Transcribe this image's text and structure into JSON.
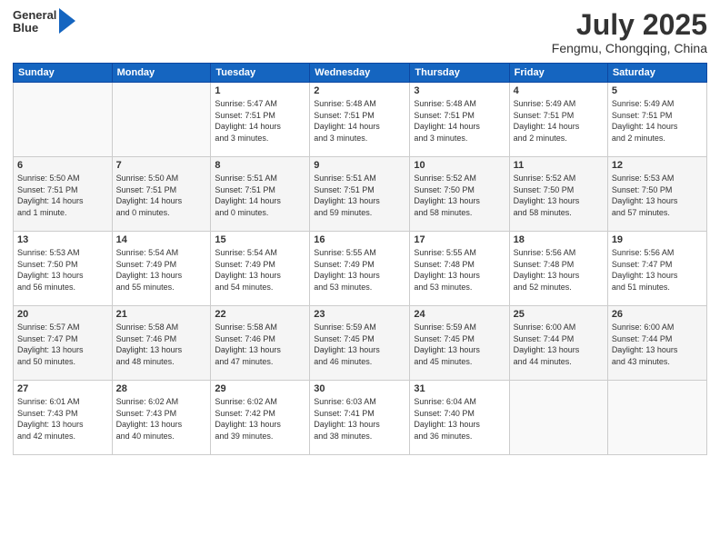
{
  "header": {
    "logo": {
      "general": "General",
      "blue": "Blue",
      "arrow_color": "#1565c0"
    },
    "month_title": "July 2025",
    "location": "Fengmu, Chongqing, China"
  },
  "calendar": {
    "days_of_week": [
      "Sunday",
      "Monday",
      "Tuesday",
      "Wednesday",
      "Thursday",
      "Friday",
      "Saturday"
    ],
    "weeks": [
      [
        {
          "day": "",
          "info": ""
        },
        {
          "day": "",
          "info": ""
        },
        {
          "day": "1",
          "info": "Sunrise: 5:47 AM\nSunset: 7:51 PM\nDaylight: 14 hours\nand 3 minutes."
        },
        {
          "day": "2",
          "info": "Sunrise: 5:48 AM\nSunset: 7:51 PM\nDaylight: 14 hours\nand 3 minutes."
        },
        {
          "day": "3",
          "info": "Sunrise: 5:48 AM\nSunset: 7:51 PM\nDaylight: 14 hours\nand 3 minutes."
        },
        {
          "day": "4",
          "info": "Sunrise: 5:49 AM\nSunset: 7:51 PM\nDaylight: 14 hours\nand 2 minutes."
        },
        {
          "day": "5",
          "info": "Sunrise: 5:49 AM\nSunset: 7:51 PM\nDaylight: 14 hours\nand 2 minutes."
        }
      ],
      [
        {
          "day": "6",
          "info": "Sunrise: 5:50 AM\nSunset: 7:51 PM\nDaylight: 14 hours\nand 1 minute."
        },
        {
          "day": "7",
          "info": "Sunrise: 5:50 AM\nSunset: 7:51 PM\nDaylight: 14 hours\nand 0 minutes."
        },
        {
          "day": "8",
          "info": "Sunrise: 5:51 AM\nSunset: 7:51 PM\nDaylight: 14 hours\nand 0 minutes."
        },
        {
          "day": "9",
          "info": "Sunrise: 5:51 AM\nSunset: 7:51 PM\nDaylight: 13 hours\nand 59 minutes."
        },
        {
          "day": "10",
          "info": "Sunrise: 5:52 AM\nSunset: 7:50 PM\nDaylight: 13 hours\nand 58 minutes."
        },
        {
          "day": "11",
          "info": "Sunrise: 5:52 AM\nSunset: 7:50 PM\nDaylight: 13 hours\nand 58 minutes."
        },
        {
          "day": "12",
          "info": "Sunrise: 5:53 AM\nSunset: 7:50 PM\nDaylight: 13 hours\nand 57 minutes."
        }
      ],
      [
        {
          "day": "13",
          "info": "Sunrise: 5:53 AM\nSunset: 7:50 PM\nDaylight: 13 hours\nand 56 minutes."
        },
        {
          "day": "14",
          "info": "Sunrise: 5:54 AM\nSunset: 7:49 PM\nDaylight: 13 hours\nand 55 minutes."
        },
        {
          "day": "15",
          "info": "Sunrise: 5:54 AM\nSunset: 7:49 PM\nDaylight: 13 hours\nand 54 minutes."
        },
        {
          "day": "16",
          "info": "Sunrise: 5:55 AM\nSunset: 7:49 PM\nDaylight: 13 hours\nand 53 minutes."
        },
        {
          "day": "17",
          "info": "Sunrise: 5:55 AM\nSunset: 7:48 PM\nDaylight: 13 hours\nand 53 minutes."
        },
        {
          "day": "18",
          "info": "Sunrise: 5:56 AM\nSunset: 7:48 PM\nDaylight: 13 hours\nand 52 minutes."
        },
        {
          "day": "19",
          "info": "Sunrise: 5:56 AM\nSunset: 7:47 PM\nDaylight: 13 hours\nand 51 minutes."
        }
      ],
      [
        {
          "day": "20",
          "info": "Sunrise: 5:57 AM\nSunset: 7:47 PM\nDaylight: 13 hours\nand 50 minutes."
        },
        {
          "day": "21",
          "info": "Sunrise: 5:58 AM\nSunset: 7:46 PM\nDaylight: 13 hours\nand 48 minutes."
        },
        {
          "day": "22",
          "info": "Sunrise: 5:58 AM\nSunset: 7:46 PM\nDaylight: 13 hours\nand 47 minutes."
        },
        {
          "day": "23",
          "info": "Sunrise: 5:59 AM\nSunset: 7:45 PM\nDaylight: 13 hours\nand 46 minutes."
        },
        {
          "day": "24",
          "info": "Sunrise: 5:59 AM\nSunset: 7:45 PM\nDaylight: 13 hours\nand 45 minutes."
        },
        {
          "day": "25",
          "info": "Sunrise: 6:00 AM\nSunset: 7:44 PM\nDaylight: 13 hours\nand 44 minutes."
        },
        {
          "day": "26",
          "info": "Sunrise: 6:00 AM\nSunset: 7:44 PM\nDaylight: 13 hours\nand 43 minutes."
        }
      ],
      [
        {
          "day": "27",
          "info": "Sunrise: 6:01 AM\nSunset: 7:43 PM\nDaylight: 13 hours\nand 42 minutes."
        },
        {
          "day": "28",
          "info": "Sunrise: 6:02 AM\nSunset: 7:43 PM\nDaylight: 13 hours\nand 40 minutes."
        },
        {
          "day": "29",
          "info": "Sunrise: 6:02 AM\nSunset: 7:42 PM\nDaylight: 13 hours\nand 39 minutes."
        },
        {
          "day": "30",
          "info": "Sunrise: 6:03 AM\nSunset: 7:41 PM\nDaylight: 13 hours\nand 38 minutes."
        },
        {
          "day": "31",
          "info": "Sunrise: 6:04 AM\nSunset: 7:40 PM\nDaylight: 13 hours\nand 36 minutes."
        },
        {
          "day": "",
          "info": ""
        },
        {
          "day": "",
          "info": ""
        }
      ]
    ]
  }
}
